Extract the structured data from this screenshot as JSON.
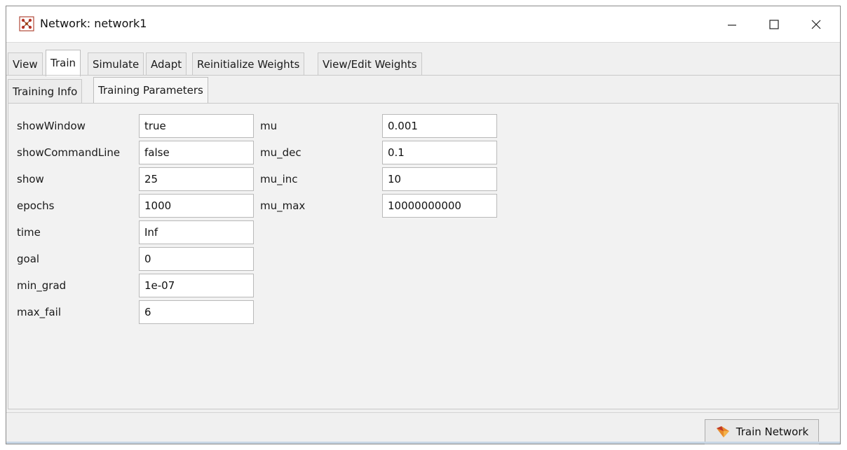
{
  "window": {
    "title": "Network: network1",
    "controls": {
      "minimize": "—",
      "maximize": "☐",
      "close": "✕"
    }
  },
  "main_tabs": [
    {
      "label": "View",
      "active": false
    },
    {
      "label": "Train",
      "active": true
    },
    {
      "label": "Simulate",
      "active": false
    },
    {
      "label": "Adapt",
      "active": false
    },
    {
      "label": "Reinitialize Weights",
      "active": false
    },
    {
      "label": "View/Edit Weights",
      "active": false
    }
  ],
  "sub_tabs": [
    {
      "label": "Training Info",
      "active": false
    },
    {
      "label": "Training Parameters",
      "active": true
    }
  ],
  "params_left": [
    {
      "name": "showWindow",
      "value": "true"
    },
    {
      "name": "showCommandLine",
      "value": "false"
    },
    {
      "name": "show",
      "value": "25"
    },
    {
      "name": "epochs",
      "value": "1000"
    },
    {
      "name": "time",
      "value": "Inf"
    },
    {
      "name": "goal",
      "value": "0"
    },
    {
      "name": "min_grad",
      "value": "1e-07"
    },
    {
      "name": "max_fail",
      "value": "6"
    }
  ],
  "params_right": [
    {
      "name": "mu",
      "value": "0.001"
    },
    {
      "name": "mu_dec",
      "value": "0.1"
    },
    {
      "name": "mu_inc",
      "value": "10"
    },
    {
      "name": "mu_max",
      "value": "10000000000"
    }
  ],
  "train_button": {
    "label": "Train Network",
    "icon": "train-network-icon"
  },
  "colors": {
    "accent_orange": "#e8892b",
    "icon_red": "#c0392b"
  }
}
